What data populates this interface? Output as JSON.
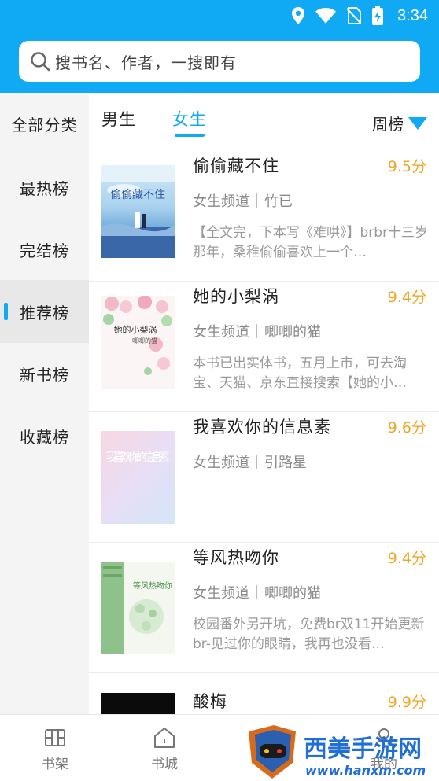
{
  "status_bar": {
    "time": "3:34",
    "icons": [
      "location-icon",
      "wifi-icon",
      "no-sim-icon",
      "battery-charging-icon"
    ]
  },
  "search": {
    "placeholder": "搜书名、作者，一搜即有"
  },
  "sidebar": {
    "all_categories": "全部分类",
    "items": [
      {
        "label": "最热榜",
        "active": false
      },
      {
        "label": "完结榜",
        "active": false
      },
      {
        "label": "推荐榜",
        "active": true
      },
      {
        "label": "新书榜",
        "active": false
      },
      {
        "label": "收藏榜",
        "active": false
      }
    ]
  },
  "tabs": [
    {
      "label": "男生",
      "active": false
    },
    {
      "label": "女生",
      "active": true
    }
  ],
  "period_selector": {
    "label": "周榜"
  },
  "books": [
    {
      "title": "偷偷藏不住",
      "score": "9.5分",
      "channel": "女生频道",
      "author": "竹已",
      "desc": "【全文完，下本写《难哄》】brbr十三岁那年，桑稚偷偷喜欢上一个…"
    },
    {
      "title": "她的小梨涡",
      "score": "9.4分",
      "channel": "女生频道",
      "author": "唧唧的猫",
      "desc": "本书已出实体书，五月上市，可去淘宝、天猫、京东直接搜索【她的小…"
    },
    {
      "title": "我喜欢你的信息素",
      "score": "9.6分",
      "channel": "女生频道",
      "author": "引路星",
      "desc": ""
    },
    {
      "title": "等风热吻你",
      "score": "9.4分",
      "channel": "女生频道",
      "author": "唧唧的猫",
      "desc": "校园番外另开坑，免费br双11开始更新br-见过你的眼睛，我再也没看…"
    },
    {
      "title": "酸梅",
      "score": "9.9分",
      "channel": "",
      "author": "",
      "desc": ""
    }
  ],
  "covers": {
    "book1": {
      "text": "偷偷藏不住"
    },
    "book2": {
      "text": "她的小梨涡",
      "author": "唧唧的猫"
    },
    "book3": {
      "text": "我喜欢你的信息素"
    },
    "book4": {
      "text": "等风热吻你"
    }
  },
  "bottom_nav": [
    {
      "label": "书架",
      "icon": "bookshelf-icon"
    },
    {
      "label": "书城",
      "icon": "home-icon"
    },
    {
      "label": "我的",
      "icon": "profile-icon"
    }
  ],
  "watermark": {
    "text": "西美手游网",
    "url_text": "www.hanxm.com"
  },
  "colors": {
    "primary": "#10a9f3",
    "score": "#f0a623"
  }
}
